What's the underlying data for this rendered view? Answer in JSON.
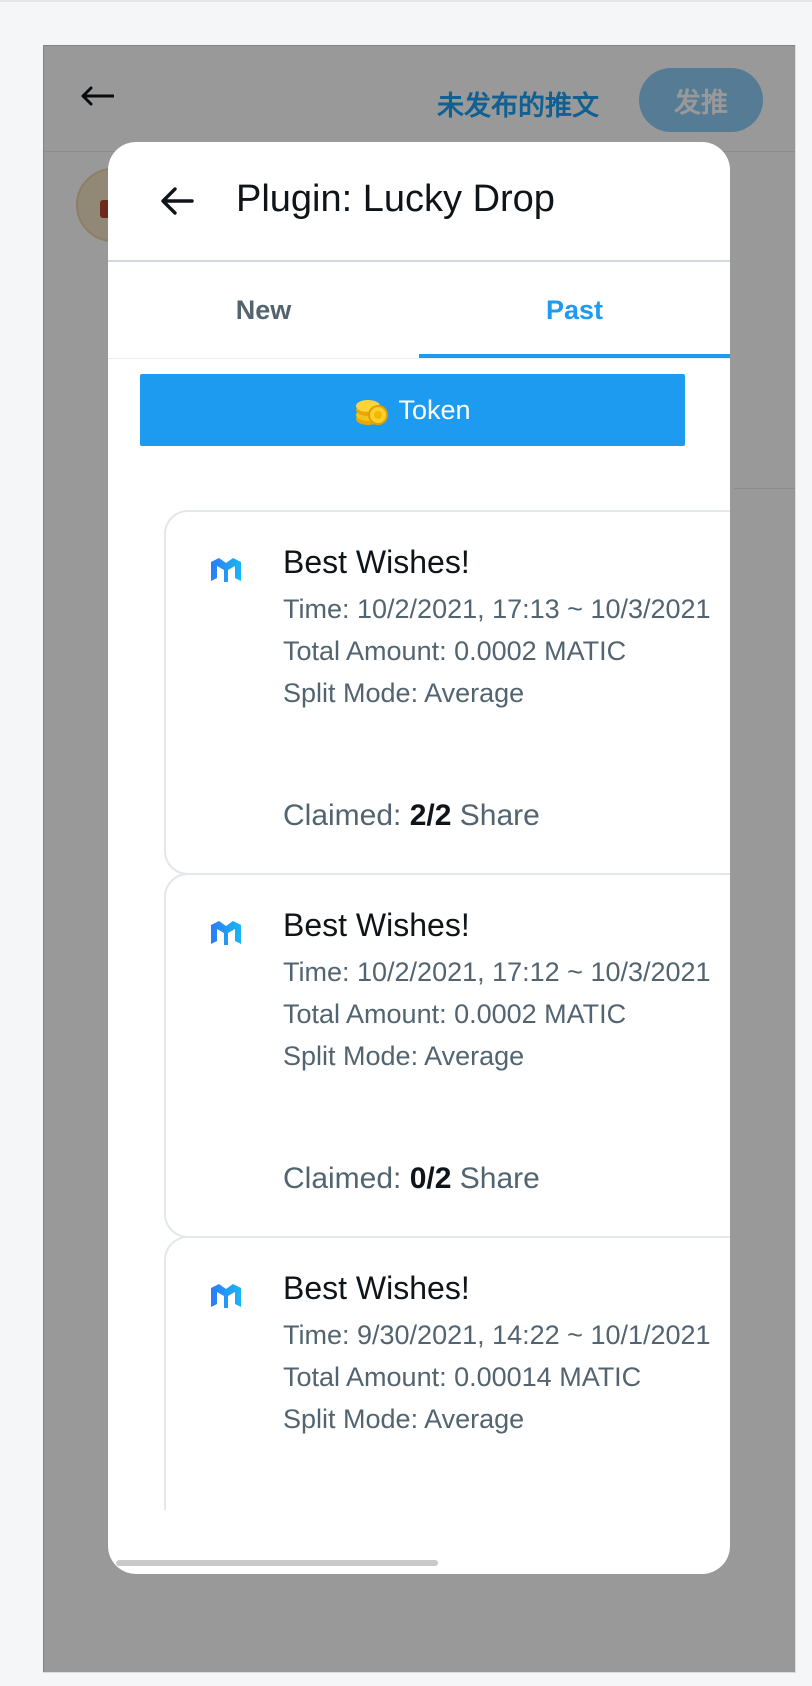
{
  "background": {
    "header": {
      "title": "未发布的推文",
      "send_label": "发推"
    }
  },
  "dialog": {
    "title": "Plugin: Lucky Drop",
    "tabs": [
      {
        "label": "New",
        "active": false
      },
      {
        "label": "Past",
        "active": true
      }
    ],
    "token_button": {
      "label": "Token",
      "icon": "coins-emoji"
    },
    "cards": [
      {
        "title": "Best Wishes!",
        "time": "Time: 10/2/2021, 17:13 ~ 10/3/2021",
        "total": "Total Amount: 0.0002 MATIC",
        "split": "Split Mode: Average",
        "claimed_label": "Claimed:",
        "claimed_value": "2/2",
        "share_label": "Share",
        "icon": "polygon-matic-logo"
      },
      {
        "title": "Best Wishes!",
        "time": "Time: 10/2/2021, 17:12 ~ 10/3/2021",
        "total": "Total Amount: 0.0002 MATIC",
        "split": "Split Mode: Average",
        "claimed_label": "Claimed:",
        "claimed_value": "0/2",
        "share_label": "Share",
        "icon": "polygon-matic-logo"
      },
      {
        "title": "Best Wishes!",
        "time": "Time: 9/30/2021, 14:22 ~ 10/1/2021",
        "total": "Total Amount: 0.00014 MATIC",
        "split": "Split Mode: Average",
        "icon": "polygon-matic-logo"
      }
    ]
  },
  "colors": {
    "accent": "#1d9bf0",
    "overlay": "rgba(0,0,0,0.40)",
    "text_primary": "#0f1419",
    "text_secondary": "#536471"
  }
}
